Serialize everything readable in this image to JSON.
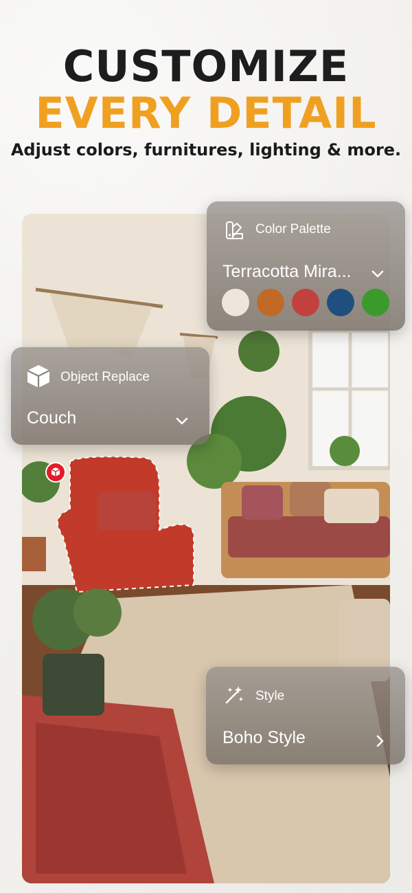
{
  "headline": {
    "line1": "CUSTOMIZE",
    "line2": "EVERY DETAIL",
    "subtitle": "Adjust colors, furnitures, lighting & more."
  },
  "color_palette": {
    "title": "Color Palette",
    "icon": "palette-icon",
    "selected": "Terracotta Mira...",
    "swatches": [
      "#ece7da",
      "#c06a26",
      "#c2413f",
      "#1f4f7f",
      "#3b9a2c"
    ]
  },
  "object_replace": {
    "title": "Object Replace",
    "icon": "cube-icon",
    "selected": "Couch"
  },
  "style": {
    "title": "Style",
    "icon": "magic-wand-icon",
    "selected": "Boho Style"
  },
  "colors": {
    "accent": "#f0a020",
    "badge": "#e11d2a"
  }
}
